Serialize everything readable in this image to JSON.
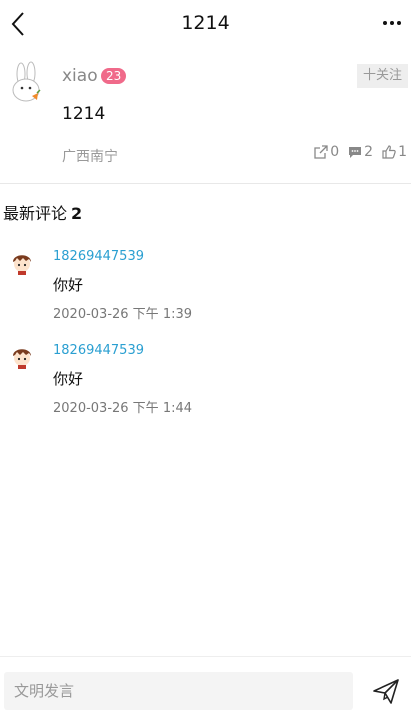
{
  "header": {
    "title": "1214"
  },
  "post": {
    "username": "xiao",
    "level": "23",
    "follow_label": "十关注",
    "content": "1214",
    "location": "广西南宁",
    "shares": "0",
    "comments": "2",
    "likes": "1"
  },
  "comments_section": {
    "title": "最新评论",
    "count": "2",
    "items": [
      {
        "user": "18269447539",
        "text": "你好",
        "time": "2020-03-26 下午 1:39"
      },
      {
        "user": "18269447539",
        "text": "你好",
        "time": "2020-03-26 下午 1:44"
      }
    ]
  },
  "composer": {
    "placeholder": "文明发言"
  },
  "colors": {
    "link": "#2a9fd1",
    "badge": "#f06a8a",
    "muted": "#999999"
  }
}
